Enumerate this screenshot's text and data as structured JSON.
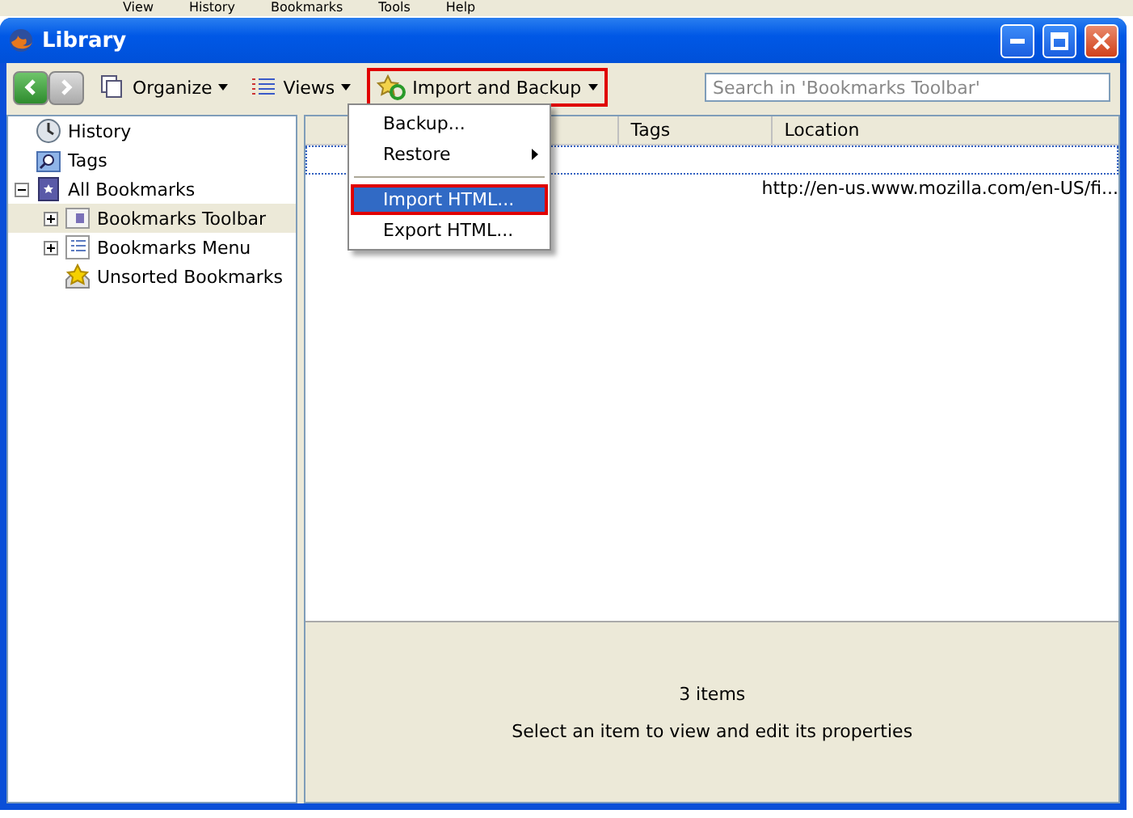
{
  "background_menu": [
    "View",
    "History",
    "Bookmarks",
    "Tools",
    "Help"
  ],
  "window": {
    "title": "Library"
  },
  "toolbar": {
    "organize": "Organize",
    "views": "Views",
    "import_backup": {
      "label": "Import and Backup",
      "annotated": true
    },
    "search": {
      "placeholder": "Search in 'Bookmarks Toolbar'"
    }
  },
  "sidebar": {
    "items": [
      {
        "label": "History",
        "kind": "history",
        "selected": false
      },
      {
        "label": "Tags",
        "kind": "tags",
        "selected": false
      },
      {
        "label": "All Bookmarks",
        "kind": "all",
        "selected": false,
        "expanded": true,
        "children": [
          {
            "label": "Bookmarks Toolbar",
            "kind": "toolbar",
            "selected": true,
            "expanded": false
          },
          {
            "label": "Bookmarks Menu",
            "kind": "menu",
            "selected": false,
            "expanded": false
          },
          {
            "label": "Unsorted Bookmarks",
            "kind": "unsorted",
            "selected": false
          }
        ]
      }
    ]
  },
  "table": {
    "columns": [
      "Tags",
      "Location"
    ],
    "rows": [
      {
        "focused": true
      },
      {
        "location": "http://en-us.www.mozilla.com/en-US/fi...",
        "focused": false
      }
    ]
  },
  "menu": {
    "items": [
      {
        "kind": "item",
        "label": "Backup...",
        "selected": false,
        "annotated": false
      },
      {
        "kind": "submenu",
        "label": "Restore",
        "selected": false,
        "annotated": false
      },
      {
        "kind": "separator"
      },
      {
        "kind": "item",
        "label": "Import HTML...",
        "selected": true,
        "annotated": true
      },
      {
        "kind": "item",
        "label": "Export HTML...",
        "selected": false,
        "annotated": false
      }
    ]
  },
  "details": {
    "count": "3 items",
    "hint": "Select an item to view and edit its properties"
  }
}
